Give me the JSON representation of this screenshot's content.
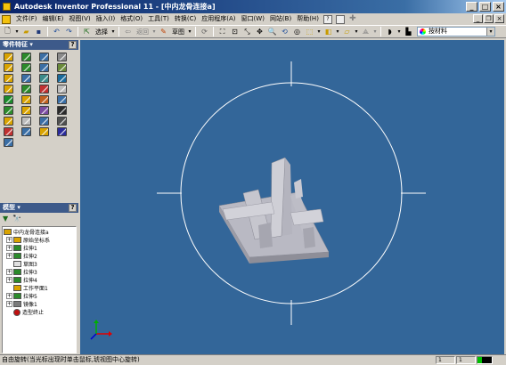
{
  "window": {
    "title": "Autodesk Inventor Professional 11 - [中内龙骨连接a]",
    "buttons": {
      "minimize": "_",
      "maximize": "□",
      "close": "×"
    }
  },
  "menu": {
    "items": [
      "文件(F)",
      "编辑(E)",
      "视图(V)",
      "插入(I)",
      "格式(O)",
      "工具(T)",
      "转换(C)",
      "应用程序(A)",
      "窗口(W)",
      "网站(B)",
      "帮助(H)"
    ],
    "help_icon": "?",
    "mdi_buttons": {
      "minimize": "_",
      "restore": "❐",
      "close": "×"
    }
  },
  "toolbar": {
    "select_label": "选择",
    "back_label": "返回",
    "sketch_label": "草图",
    "material_value": "按材料"
  },
  "feature_panel": {
    "title": "零件特征 ▾",
    "help": "?"
  },
  "model_panel": {
    "title": "模型 ▾",
    "help": "?",
    "tree": [
      {
        "label": "中内龙骨连接a",
        "level": 0,
        "expand": "",
        "icon": "part"
      },
      {
        "label": "原始坐标系",
        "level": 1,
        "expand": "+",
        "icon": "folder"
      },
      {
        "label": "拉伸1",
        "level": 1,
        "expand": "+",
        "icon": "extrude"
      },
      {
        "label": "拉伸2",
        "level": 1,
        "expand": "+",
        "icon": "extrude"
      },
      {
        "label": "草图3",
        "level": 1,
        "expand": "",
        "icon": "sketch"
      },
      {
        "label": "拉伸3",
        "level": 1,
        "expand": "+",
        "icon": "extrude"
      },
      {
        "label": "拉伸4",
        "level": 1,
        "expand": "+",
        "icon": "extrude"
      },
      {
        "label": "工作平面1",
        "level": 1,
        "expand": "",
        "icon": "plane"
      },
      {
        "label": "拉伸5",
        "level": 1,
        "expand": "+",
        "icon": "extrude"
      },
      {
        "label": "镜像1",
        "level": 1,
        "expand": "+",
        "icon": "mirror"
      },
      {
        "label": "造型终止",
        "level": 1,
        "expand": "",
        "icon": "end"
      }
    ]
  },
  "status": {
    "message": "自由旋转(当光标出现时单击鼠标,琥视图中心旋转)",
    "box1": "1",
    "box2": "1"
  },
  "colors": {
    "viewport_bg": "#336699",
    "part_face": "#c0c0c8",
    "part_shade": "#9a9aa4",
    "rotate_circle": "#ffffff"
  }
}
